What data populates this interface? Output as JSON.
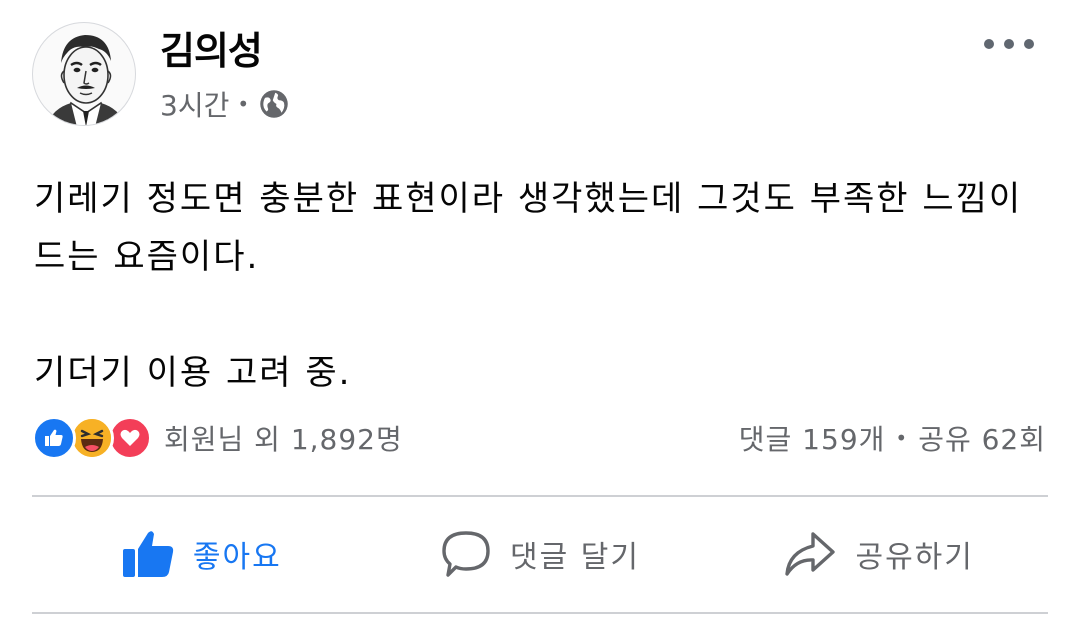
{
  "post": {
    "author": "김의성",
    "time": "3시간",
    "separator": "•",
    "privacy_icon": "globe-icon",
    "more_icon": "more-options-icon",
    "text_lines": [
      "기레기 정도면 충분한 표현이라 생각했는데 그것도 부족한 느낌이",
      "드는 요즘이다.",
      "기더기 이용 고려 중."
    ]
  },
  "engagement": {
    "reaction_icons": [
      "like-reaction-icon",
      "haha-reaction-icon",
      "love-reaction-icon"
    ],
    "reaction_summary": "회원님 외 1,892명",
    "comments": "댓글 159개",
    "separator": "•",
    "shares": "공유 62회"
  },
  "actions": {
    "like_label": "좋아요",
    "comment_label": "댓글 달기",
    "share_label": "공유하기"
  },
  "colors": {
    "facebook_blue": "#1877f2",
    "text_secondary": "#65676b",
    "divider": "#ced0d4"
  }
}
